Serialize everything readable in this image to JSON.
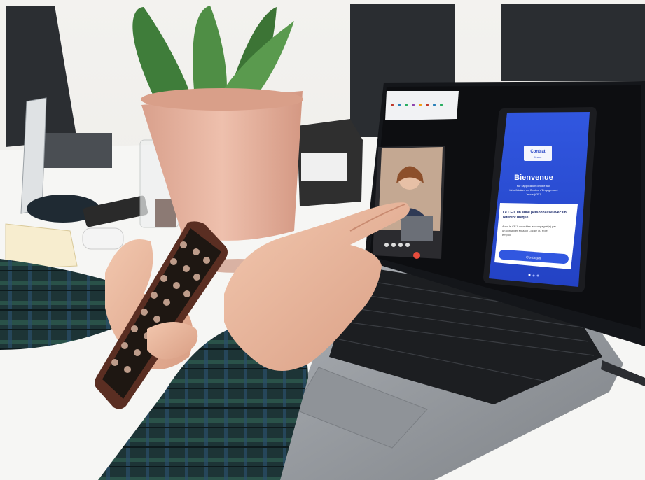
{
  "phone_app": {
    "welcome_title": "Bienvenue",
    "welcome_subtitle_line1": "sur l'application dédiée aux",
    "welcome_subtitle_line2": "bénéficiaires du Contrat d'Engagement",
    "welcome_subtitle_line3": "Jeune (CEJ)",
    "card_title_line1": "Le CEJ, un suivi personnalisé avec un",
    "card_title_line2": "référent unique",
    "card_body_line1": "Avec le CEJ, vous êtes accompagné(e) par",
    "card_body_line2": "un conseiller Mission Locale ou Pôle",
    "card_body_line3": "emploi",
    "continue_button": "Continuer",
    "logo_line1": "Contrat",
    "logo_line2": "d'Engagement",
    "logo_line3": "Jeune"
  },
  "colors": {
    "wall": "#f2f1ee",
    "desk": "#f7f7f5",
    "laptop_body": "#9a9ea3",
    "keyboard": "#1c1e21",
    "screen": "#0e0f12",
    "phone_app_blue": "#2c4fd6",
    "pot": "#e8b7a3",
    "shirt": "#1f3a3a"
  }
}
